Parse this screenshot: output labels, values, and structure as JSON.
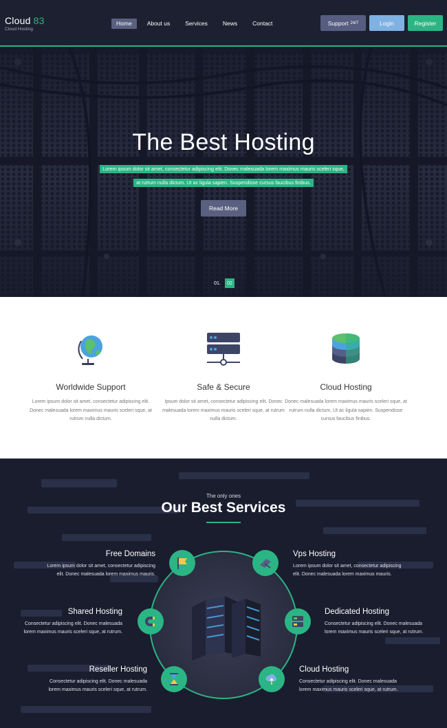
{
  "header": {
    "logo_text": "Cloud ",
    "logo_accent": "83",
    "logo_sub": "Cloud Hosting",
    "nav": [
      "Home",
      "About us",
      "Services",
      "News",
      "Contact"
    ],
    "support_label": "Support",
    "support_suffix": "24/7",
    "login_label": "Login",
    "register_label": "Register"
  },
  "hero": {
    "title": "The Best Hosting",
    "line1": "Lorem ipsum dolor sit amet, consectetur adipiscing elit. Donec malesuada lorem maximus mauris sceleri sque,",
    "line2": "at rutrum nulla dictum. Ut ac ligula sapien. Suspendisse cursus faucibus finibus.",
    "button": "Read More",
    "pager": [
      "01.",
      "02"
    ]
  },
  "features": [
    {
      "title": "Worldwide Support",
      "icon": "globe-icon",
      "text": "Lorem ipsum dolor sit amet, consectetur adipiscing elit. Donec malesuada lorem maximus mauris sceleri sque, at rutrum nulla dictum."
    },
    {
      "title": "Safe & Secure",
      "icon": "server-network-icon",
      "text": "Ipsum dolor sit amet, consectetur adipiscing elit. Donec malesuada lorem maximus mauris sceleri sque, at rutrum nulla dictum."
    },
    {
      "title": "Cloud Hosting",
      "icon": "database-stack-icon",
      "text": "Donec malesuada lorem maximus mauris sceleri sque, at rutrum nulla dictum. Ut ac ligula sapien. Suspendisse cursus faucibus finibus."
    }
  ],
  "services": {
    "kicker": "The only ones",
    "title": "Our Best Services",
    "items": [
      {
        "name": "Free Domains",
        "icon": "flag-icon",
        "desc1": "Lorem ipsum dolor sit amet, consectetur adipiscing",
        "desc2": "elit. Donec malesuada lorem maximus mauris."
      },
      {
        "name": "Vps Hosting",
        "icon": "satellite-icon",
        "desc1": "Lorem ipsum dolor sit amet, consectetur adipiscing",
        "desc2": "elit. Donec malesuada lorem maximus mauris."
      },
      {
        "name": "Shared Hosting",
        "icon": "magnet-icon",
        "desc1": "Consectetur adipiscing elit. Donec malesuada",
        "desc2": "lorem maximus mauris sceleri sque, at rutrum."
      },
      {
        "name": "Dedicated Hosting",
        "icon": "dedicated-server-icon",
        "desc1": "Consectetur adipiscing elit. Donec malesuada",
        "desc2": "lorem maximus mauris sceleri sque, at rutrum."
      },
      {
        "name": "Reseller Hosting",
        "icon": "hourglass-icon",
        "desc1": "Consectetur adipiscing elit. Donec malesuada",
        "desc2": "lorem maximus mauris sceleri sque, at rutrum."
      },
      {
        "name": "Cloud Hosting",
        "icon": "cloud-upload-icon",
        "desc1": "Consectetur adipiscing elit. Donec malesuada",
        "desc2": "lorem maximus mauris sceleri sque, at rutrum."
      }
    ]
  },
  "colors": {
    "accent": "#2bb585",
    "dark": "#1d2030",
    "button": "#5a6080",
    "login": "#7fb1e3"
  }
}
